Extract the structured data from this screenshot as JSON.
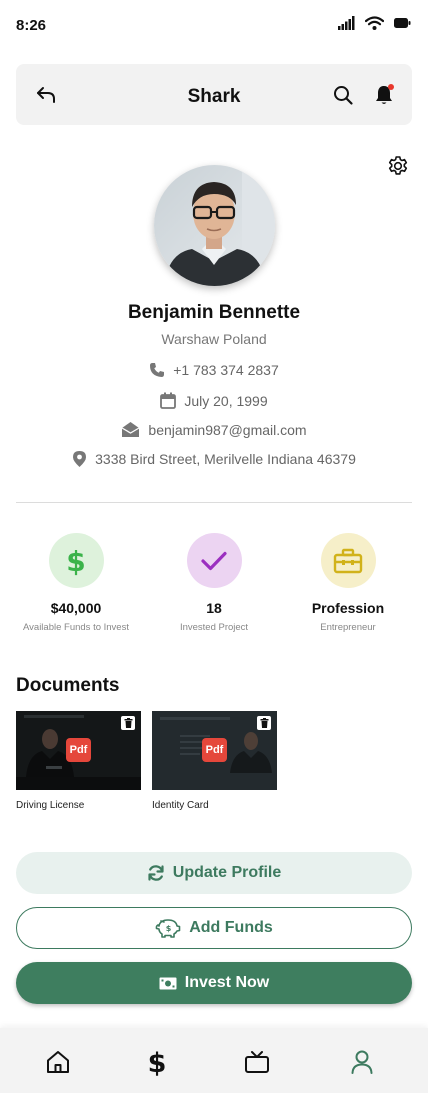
{
  "status_bar": {
    "time": "8:26"
  },
  "header": {
    "title": "Shark"
  },
  "profile": {
    "name": "Benjamin Bennette",
    "location": "Warshaw Poland",
    "phone": "+1 783 374 2837",
    "birthdate": "July 20, 1999",
    "email": "benjamin987@gmail.com",
    "address": "3338 Bird Street, Merilvelle Indiana 46379"
  },
  "stats": [
    {
      "value": "$40,000",
      "caption": "Available Funds to Invest",
      "icon": "dollar-icon",
      "bg": "#def2dc",
      "fg": "#3bb34a"
    },
    {
      "value": "18",
      "caption": "Invested Project",
      "icon": "check-icon",
      "bg": "#ecd4f2",
      "fg": "#9b2fc0"
    },
    {
      "value": "Profession",
      "caption": "Entrepreneur",
      "icon": "briefcase-icon",
      "bg": "#f6efc9",
      "fg": "#d1b21a"
    }
  ],
  "documents": {
    "title": "Documents",
    "items": [
      {
        "label": "Driving License",
        "badge": "Pdf"
      },
      {
        "label": "Identity Card",
        "badge": "Pdf"
      }
    ]
  },
  "actions": {
    "update_profile": "Update Profile",
    "add_funds": "Add Funds",
    "invest_now": "Invest Now"
  },
  "nav": {
    "items": [
      "home-icon",
      "dollar-icon",
      "tv-icon",
      "user-icon"
    ],
    "active": "user-icon",
    "active_color": "#3d7a5f"
  },
  "colors": {
    "accent": "#3e7e5f",
    "notification_dot": "#e8372c"
  }
}
